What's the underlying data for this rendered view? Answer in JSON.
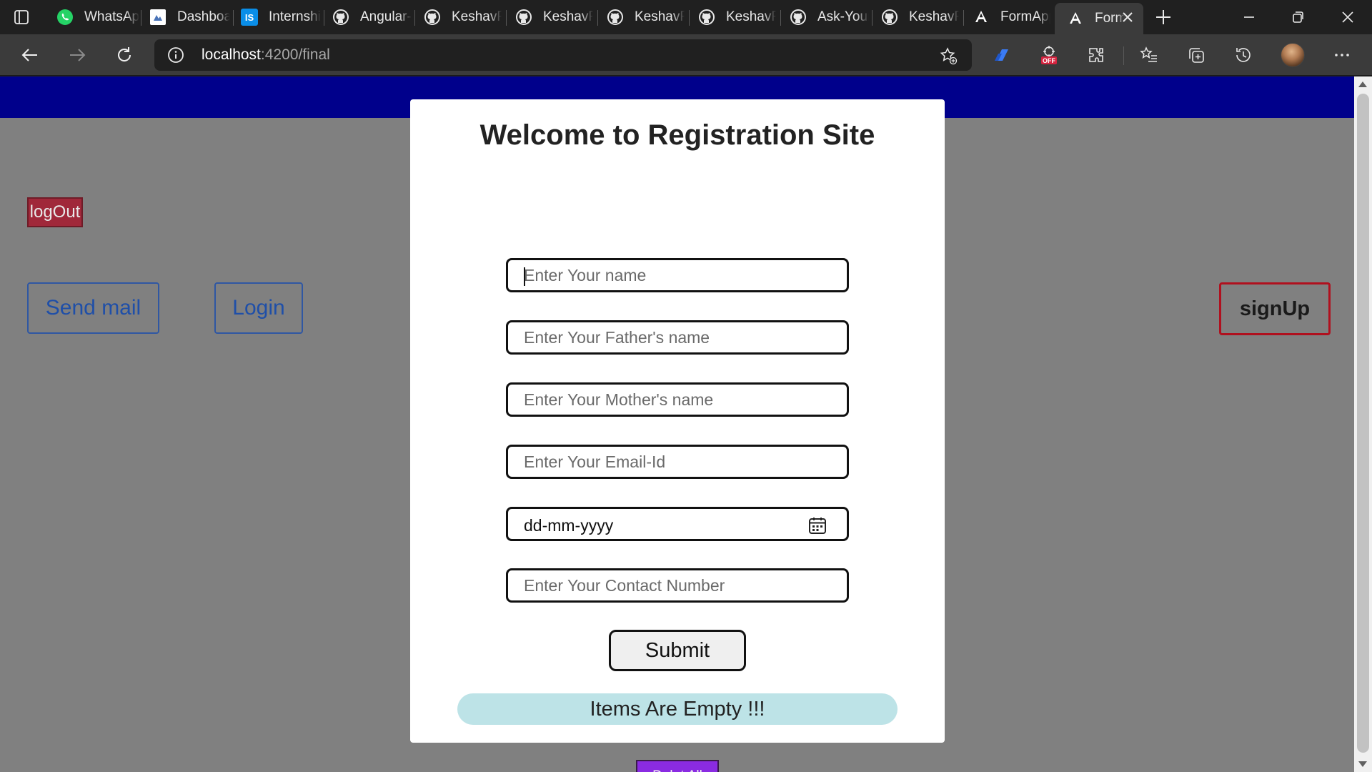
{
  "browser": {
    "tabs": [
      {
        "title": "WhatsAp",
        "icon": "whatsapp-icon"
      },
      {
        "title": "Dashboa",
        "icon": "dashboard-site-icon"
      },
      {
        "title": "Internshi",
        "icon": "internshala-icon"
      },
      {
        "title": "Angular-",
        "icon": "github-icon"
      },
      {
        "title": "KeshavRu",
        "icon": "github-icon"
      },
      {
        "title": "KeshavRu",
        "icon": "github-icon"
      },
      {
        "title": "KeshavRu",
        "icon": "github-icon"
      },
      {
        "title": "KeshavRu",
        "icon": "github-icon"
      },
      {
        "title": "Ask-Your",
        "icon": "github-icon"
      },
      {
        "title": "KeshavRu",
        "icon": "github-icon"
      },
      {
        "title": "FormApp",
        "icon": "angular-icon"
      }
    ],
    "active_tab": {
      "title": "Form",
      "icon": "angular-icon"
    },
    "url": {
      "host": "localhost",
      "rest": ":4200/final"
    },
    "colors": {
      "chrome_dark": "#202020",
      "toolbar": "#3b3b3b"
    }
  },
  "page": {
    "colors": {
      "background": "#808080",
      "top_band": "#00008b",
      "logout": "#a0283a",
      "delete": "#8a2be2",
      "banner": "#bde3e7",
      "signup_border": "#b0101e",
      "link_blue": "#1f4fa8"
    },
    "logout_label": "logOut",
    "send_mail_label": "Send mail",
    "login_label": "Login",
    "signup_label": "signUp",
    "form": {
      "title": "Welcome to Registration Site",
      "name_placeholder": "Enter Your name",
      "father_placeholder": "Enter Your Father's name",
      "mother_placeholder": "Enter Your Mother's name",
      "email_placeholder": "Enter Your Email-Id",
      "date_value": "dd-mm-yyyy",
      "contact_placeholder": "Enter Your Contact Number",
      "submit_label": "Submit",
      "empty_message": "Items Are Empty !!!",
      "delete_all_label": "Delet All"
    }
  }
}
